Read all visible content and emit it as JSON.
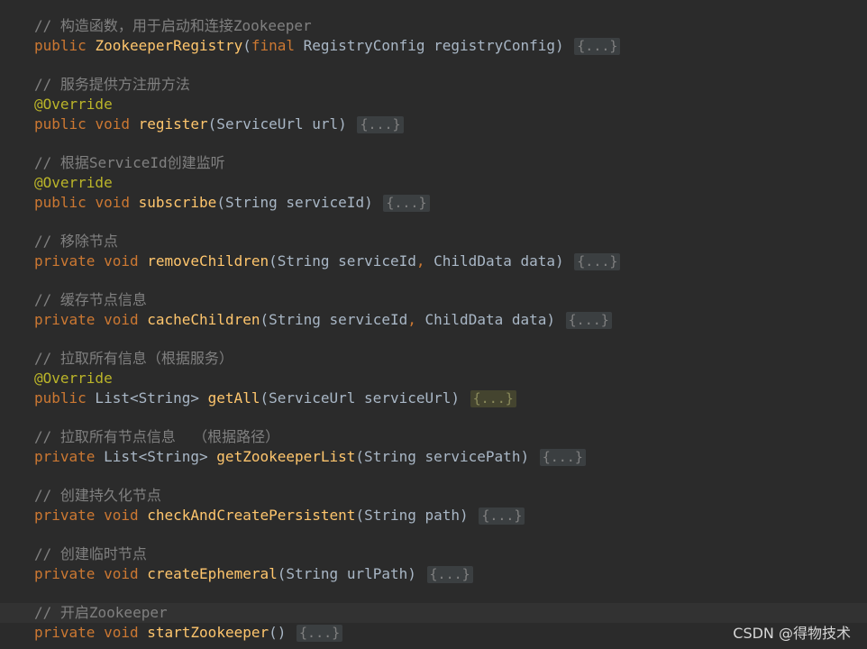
{
  "colors": {
    "background": "#2b2b2b",
    "keyword": "#cc7832",
    "annotation": "#bbb529",
    "method": "#ffc66d",
    "comment": "#808080",
    "text": "#a9b7c6"
  },
  "code": {
    "c1": "// 构造函数，用于启动和连接Zookeeper",
    "m1": {
      "k1": "public",
      "name": "ZookeeperRegistry",
      "p1": "(",
      "k2": "final",
      "rest": " RegistryConfig registryConfig)",
      "fold": "{...}"
    },
    "c2": "// 服务提供方注册方法",
    "a2": "@Override",
    "m2": {
      "k1": "public",
      "k2": "void",
      "name": "register",
      "rest": "(ServiceUrl url)",
      "fold": "{...}"
    },
    "c3": "// 根据ServiceId创建监听",
    "a3": "@Override",
    "m3": {
      "k1": "public",
      "k2": "void",
      "name": "subscribe",
      "rest": "(String serviceId)",
      "fold": "{...}"
    },
    "c4": "// 移除节点",
    "m4": {
      "k1": "private",
      "k2": "void",
      "name": "removeChildren",
      "r1": "(String serviceId",
      "comma": ",",
      "r2": " ChildData data)",
      "fold": "{...}"
    },
    "c5": "// 缓存节点信息",
    "m5": {
      "k1": "private",
      "k2": "void",
      "name": "cacheChildren",
      "r1": "(String serviceId",
      "comma": ",",
      "r2": " ChildData data)",
      "fold": "{...}"
    },
    "c6": "// 拉取所有信息（根据服务）",
    "a6": "@Override",
    "m6": {
      "k1": "public",
      "type": " List<String> ",
      "name": "getAll",
      "rest": "(ServiceUrl serviceUrl)",
      "fold": "{...}"
    },
    "c7": "// 拉取所有节点信息  （根据路径）",
    "m7": {
      "k1": "private",
      "type": " List<String> ",
      "name": "getZookeeperList",
      "rest": "(String servicePath)",
      "fold": "{...}"
    },
    "c8": "// 创建持久化节点",
    "m8": {
      "k1": "private",
      "k2": "void",
      "name": "checkAndCreatePersistent",
      "rest": "(String path)",
      "fold": "{...}"
    },
    "c9": "// 创建临时节点",
    "m9": {
      "k1": "private",
      "k2": "void",
      "name": "createEphemeral",
      "rest": "(String urlPath)",
      "fold": "{...}"
    },
    "c10": "// 开启Zookeeper",
    "m10": {
      "k1": "private",
      "k2": "void",
      "name": "startZookeeper",
      "rest": "()",
      "fold": "{...}"
    }
  },
  "watermark": "CSDN @得物技术"
}
